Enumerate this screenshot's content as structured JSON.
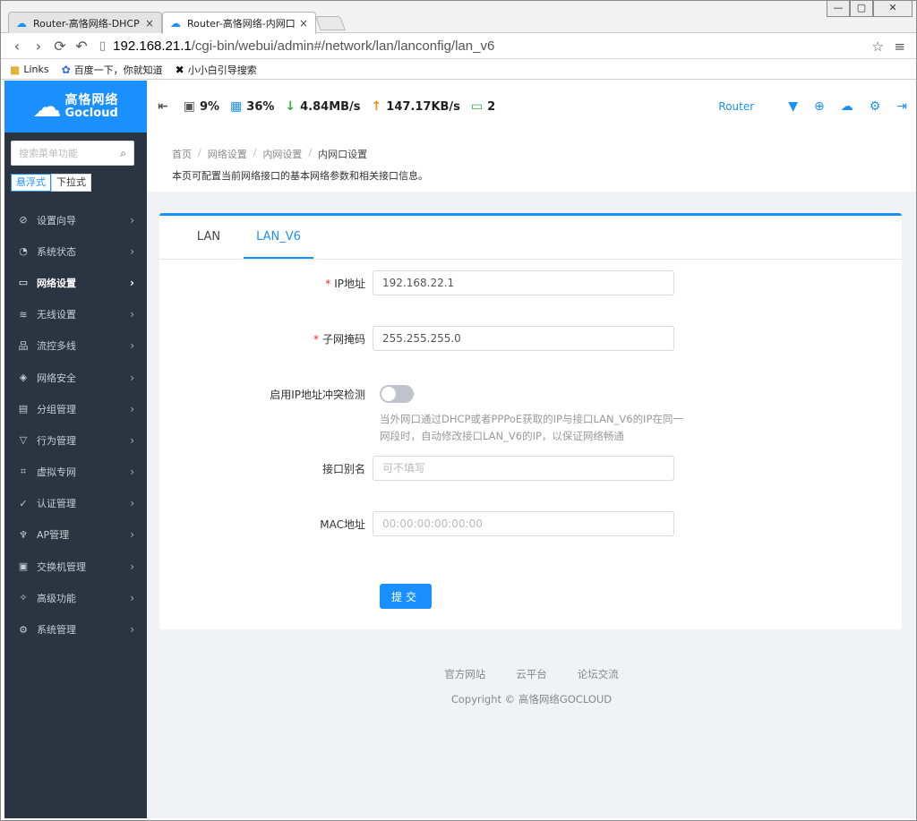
{
  "browser": {
    "tabs": [
      {
        "title": "Router-高恪网络-DHCP",
        "close": "×"
      },
      {
        "title": "Router-高恪网络-内网口设",
        "close": "×"
      }
    ],
    "window_buttons": {
      "minimize": "—",
      "maximize": "▢",
      "close": "✕"
    },
    "url_host": "192.168.21.1",
    "url_path": "/cgi-bin/webui/admin#/network/lan/lanconfig/lan_v6",
    "bookmarks": [
      "Links",
      "百度一下，你就知道",
      "小小白引导搜索"
    ]
  },
  "logo": {
    "cn": "高恪网络",
    "en": "Gocloud"
  },
  "sidebar": {
    "search_placeholder": "搜索菜单功能",
    "modes": [
      "悬浮式",
      "下拉式"
    ],
    "items": [
      {
        "label": "设置向导",
        "icon": "compass-icon"
      },
      {
        "label": "系统状态",
        "icon": "gauge-icon"
      },
      {
        "label": "网络设置",
        "icon": "monitor-icon"
      },
      {
        "label": "无线设置",
        "icon": "wifi-icon"
      },
      {
        "label": "流控多线",
        "icon": "network-icon"
      },
      {
        "label": "网络安全",
        "icon": "shield-icon"
      },
      {
        "label": "分组管理",
        "icon": "list-icon"
      },
      {
        "label": "行为管理",
        "icon": "filter-icon"
      },
      {
        "label": "虚拟专网",
        "icon": "vpn-icon"
      },
      {
        "label": "认证管理",
        "icon": "check-shield-icon"
      },
      {
        "label": "AP管理",
        "icon": "ap-icon"
      },
      {
        "label": "交换机管理",
        "icon": "switch-icon"
      },
      {
        "label": "高级功能",
        "icon": "pin-icon"
      },
      {
        "label": "系统管理",
        "icon": "gear-icon"
      }
    ]
  },
  "topbar": {
    "cpu": "9%",
    "memory": "36%",
    "download": "4.84MB/s",
    "upload": "147.17KB/s",
    "devices": "2",
    "router_link": "Router"
  },
  "breadcrumb": [
    "首页",
    "网络设置",
    "内网设置",
    "内网口设置"
  ],
  "breadcrumb_sep": "/",
  "description": "本页可配置当前网络接口的基本网络参数和相关接口信息。",
  "tabs": [
    "LAN",
    "LAN_V6"
  ],
  "form": {
    "ip_label": "IP地址",
    "ip_value": "192.168.22.1",
    "mask_label": "子网掩码",
    "mask_value": "255.255.255.0",
    "conflict_label": "启用IP地址冲突检测",
    "conflict_enabled": false,
    "conflict_hint": "当外网口通过DHCP或者PPPoE获取的IP与接口LAN_V6的IP在同一网段时，自动修改接口LAN_V6的IP，以保证网络畅通",
    "alias_label": "接口别名",
    "alias_placeholder": "可不填写",
    "mac_label": "MAC地址",
    "mac_placeholder": "00:00:00:00:00:00",
    "required_mark": "*",
    "submit": "提交"
  },
  "footer": {
    "links": [
      "官方网站",
      "云平台",
      "论坛交流"
    ],
    "copyright": "Copyright © 高恪网络GOCLOUD"
  },
  "colors": {
    "primary": "#1a90ff",
    "sidebar": "#2b3441",
    "required": "#f5222d"
  }
}
